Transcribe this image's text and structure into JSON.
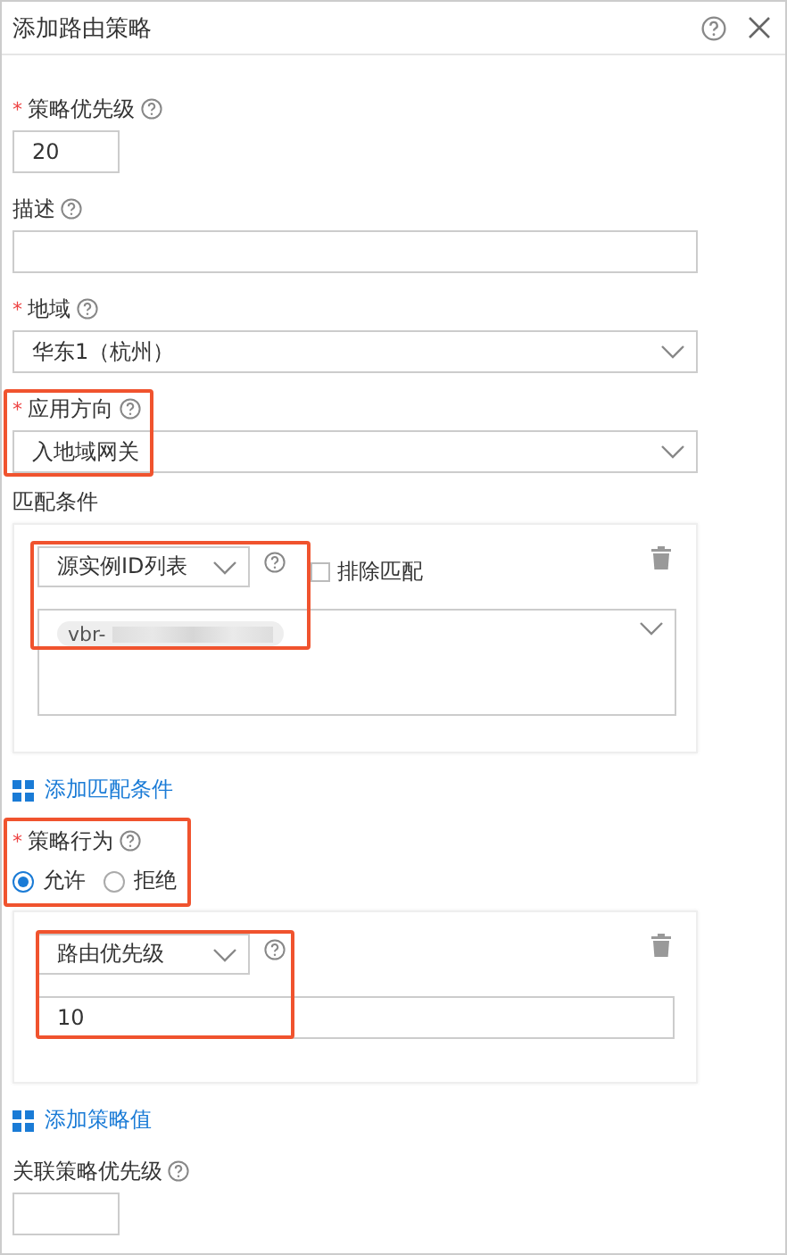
{
  "dialog": {
    "title": "添加路由策略"
  },
  "fields": [
    {
      "kind": "short_input",
      "label": "策略优先级",
      "required_mark": "*",
      "value": "20",
      "highlighted": false
    },
    {
      "kind": "input",
      "label": "描述",
      "highlighted": false
    },
    {
      "kind": "select",
      "label": "地域",
      "required_mark": "*",
      "value": "华东1（杭州）",
      "highlighted": false
    },
    {
      "kind": "select",
      "label": "应用方向",
      "required_mark": "*",
      "value": "入地域网关",
      "highlighted": true
    }
  ],
  "match_conditions": {
    "label": "匹配条件",
    "condition": {
      "type": "源实例ID列表",
      "highlighted": true,
      "exclude_label": "排除匹配",
      "exclude_checked": false,
      "tags": [
        {
          "text": "vbr-",
          "redacted": true
        }
      ]
    },
    "add_link": "添加匹配条件"
  },
  "action": {
    "label": "策略行为",
    "required_mark": "*",
    "highlighted": true,
    "options": [
      {
        "label": "允许",
        "selected": true
      },
      {
        "label": "拒绝",
        "selected": false
      }
    ]
  },
  "policy_value": {
    "type": "路由优先级",
    "value": "10",
    "highlighted": true,
    "add_link": "添加策略值"
  },
  "associated": {
    "label": "关联策略优先级"
  }
}
